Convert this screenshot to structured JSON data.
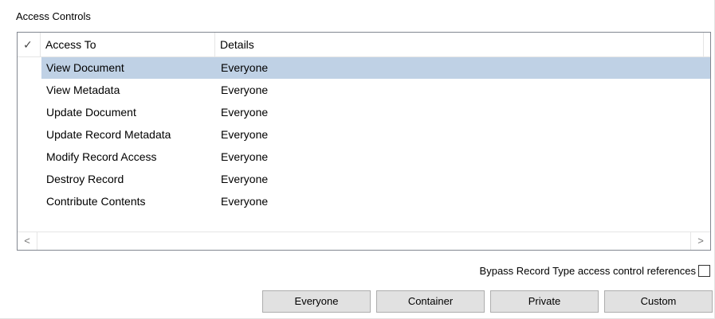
{
  "group_label": "Access Controls",
  "list": {
    "header": {
      "check_glyph": "✓",
      "col_access": "Access To",
      "col_details": "Details"
    },
    "rows": [
      {
        "access": "View Document",
        "details": "Everyone",
        "selected": true
      },
      {
        "access": "View Metadata",
        "details": "Everyone",
        "selected": false
      },
      {
        "access": "Update Document",
        "details": "Everyone",
        "selected": false
      },
      {
        "access": "Update Record Metadata",
        "details": "Everyone",
        "selected": false
      },
      {
        "access": "Modify Record Access",
        "details": "Everyone",
        "selected": false
      },
      {
        "access": "Destroy Record",
        "details": "Everyone",
        "selected": false
      },
      {
        "access": "Contribute Contents",
        "details": "Everyone",
        "selected": false
      }
    ],
    "scroll_left": "<",
    "scroll_right": ">"
  },
  "bypass_label": "Bypass Record Type access control references",
  "bypass_checked": false,
  "buttons": {
    "everyone": "Everyone",
    "container": "Container",
    "private": "Private",
    "custom": "Custom"
  },
  "colors": {
    "selection": "#bfd1e5",
    "button_bg": "#e1e1e1"
  }
}
